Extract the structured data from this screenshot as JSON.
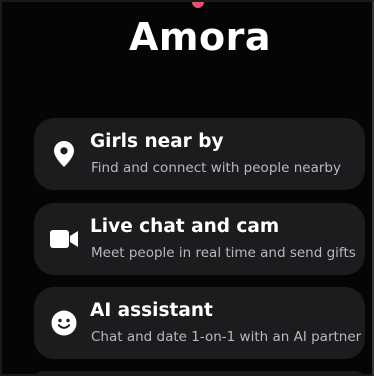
{
  "header": {
    "app_title": "Amora"
  },
  "cards": [
    {
      "title": "Girls near by",
      "subtitle": "Find and connect with people nearby",
      "icon": "location-pin-icon"
    },
    {
      "title": "Live chat and cam",
      "subtitle": "Meet people in real time and send gifts",
      "icon": "video-camera-icon"
    },
    {
      "title": "AI assistant",
      "subtitle": "Chat and date 1-on-1 with an AI partner",
      "icon": "smiley-face-icon"
    }
  ],
  "colors": {
    "background": "#050505",
    "card": "#1c1c1e",
    "title_text": "#ffffff",
    "subtitle_text": "#b9b9be",
    "accent_dot": "#e0566b"
  }
}
